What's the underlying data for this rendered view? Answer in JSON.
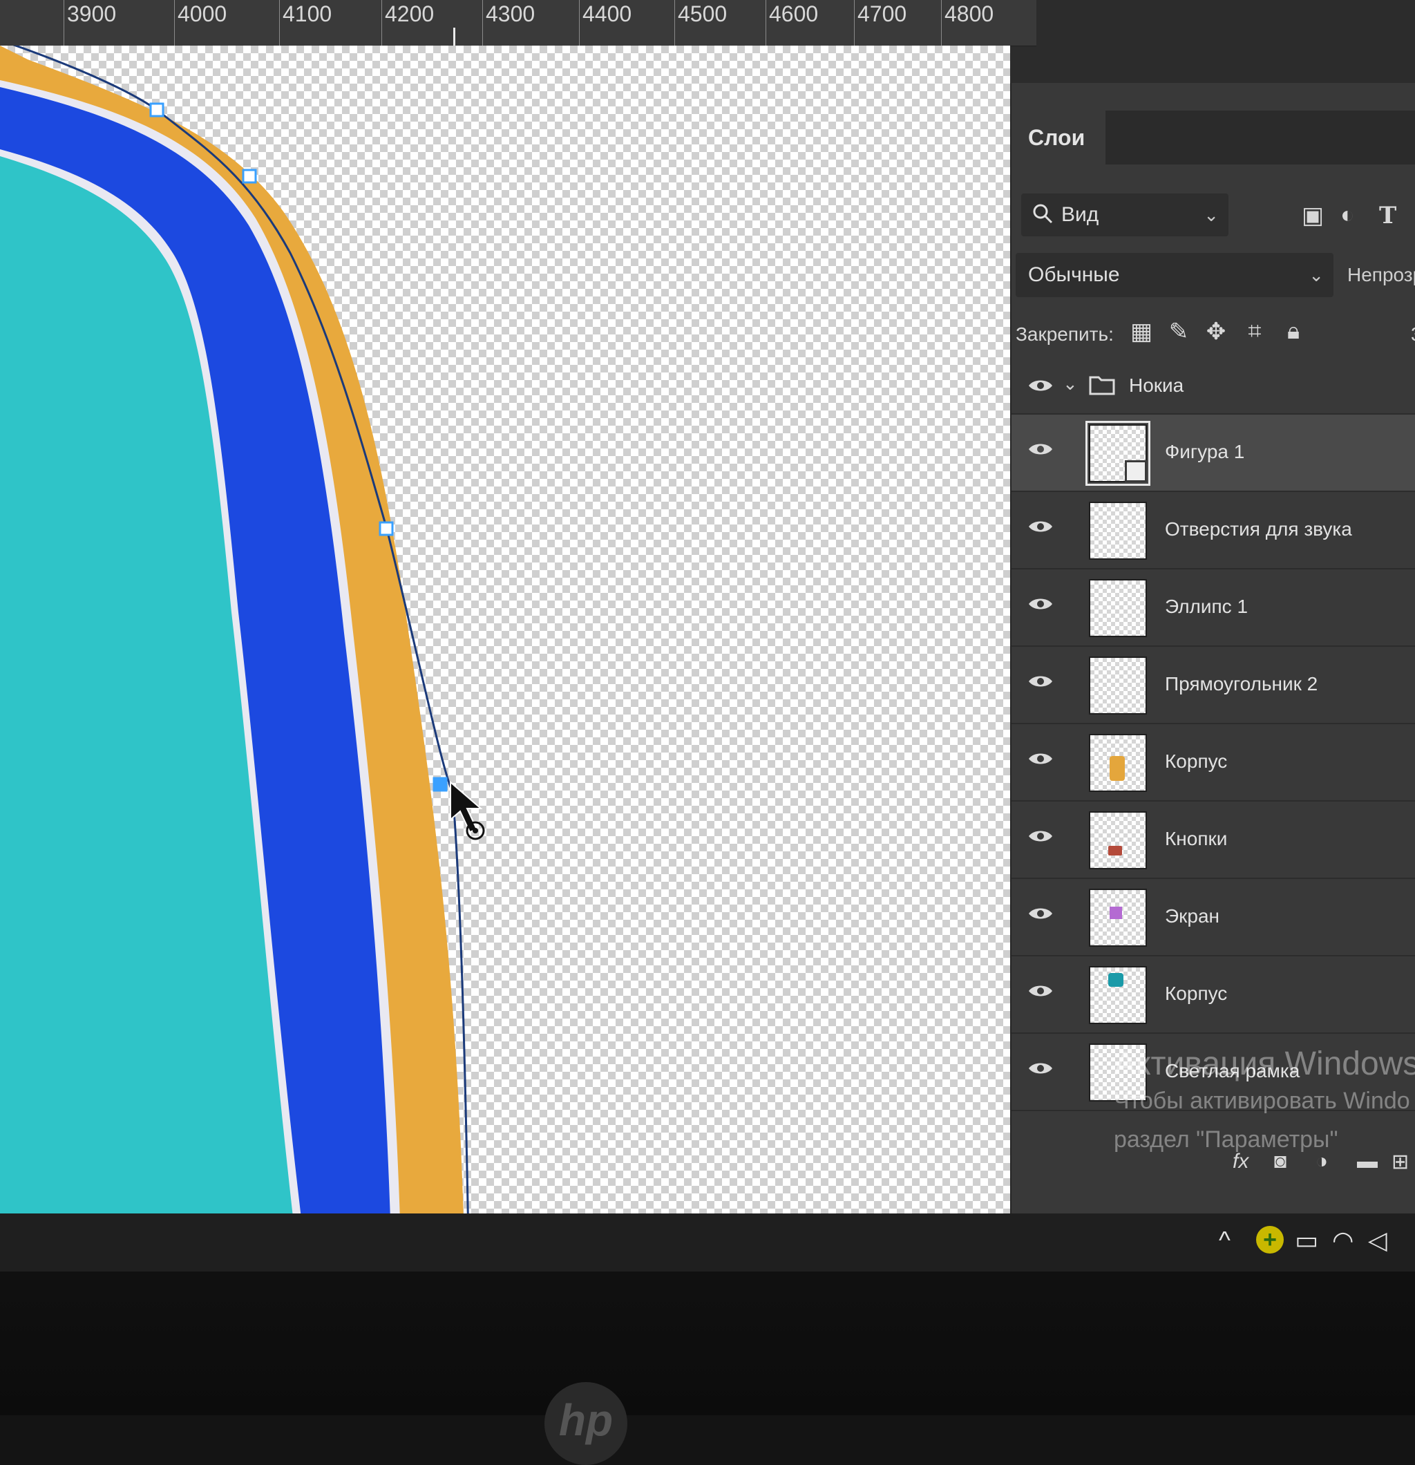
{
  "ruler": {
    "ticks": [
      "3900",
      "4000",
      "4100",
      "4200",
      "4300",
      "4400",
      "4500",
      "4600",
      "4700",
      "4800"
    ]
  },
  "panel": {
    "tab_label": "Слои",
    "filter": {
      "label": "Вид",
      "icon": "search-icon"
    },
    "filter_icons": [
      "image-filter-icon",
      "adjustment-filter-icon",
      "type-filter-icon"
    ],
    "blend_mode": "Обычные",
    "opacity_label": "Непрозра",
    "lock_label": "Закрепить:",
    "lock_icons": [
      "lock-transparent-icon",
      "lock-paint-icon",
      "lock-position-icon",
      "lock-artboard-icon",
      "lock-all-icon"
    ],
    "fill_value_partial": "3"
  },
  "layers": [
    {
      "name": "Нокиа",
      "type": "group",
      "visible": true
    },
    {
      "name": "Фигура 1",
      "type": "shape",
      "visible": true,
      "selected": true
    },
    {
      "name": "Отверстия для звука",
      "type": "pixel",
      "visible": true
    },
    {
      "name": "Эллипс 1",
      "type": "pixel",
      "visible": true
    },
    {
      "name": "Прямоугольник 2",
      "type": "pixel",
      "visible": true
    },
    {
      "name": "Корпус",
      "type": "pixel",
      "visible": true,
      "thumb_color": "#e4a63c"
    },
    {
      "name": "Кнопки",
      "type": "pixel",
      "visible": true,
      "thumb_color": "#b44a3a"
    },
    {
      "name": "Экран",
      "type": "pixel",
      "visible": true,
      "thumb_color": "#b46ad2"
    },
    {
      "name": "Корпус",
      "type": "pixel",
      "visible": true,
      "thumb_color": "#1a9aa8"
    },
    {
      "name": "Светлая рамка",
      "type": "pixel",
      "visible": true
    }
  ],
  "footer_icons": [
    "fx-icon",
    "mask-icon",
    "adjustment-icon",
    "folder-icon",
    "new-layer-icon"
  ],
  "watermark": {
    "title": "Активация Windows",
    "line1": "Чтобы активировать Windo",
    "line2": "раздел \"Параметры\""
  },
  "footer_fx": "fx",
  "colors": {
    "teal": "#2fc4c8",
    "blue": "#1c49e0",
    "orange": "#e8a93d",
    "path": "#1b3a7a",
    "anchor": "#3aa0ff"
  }
}
